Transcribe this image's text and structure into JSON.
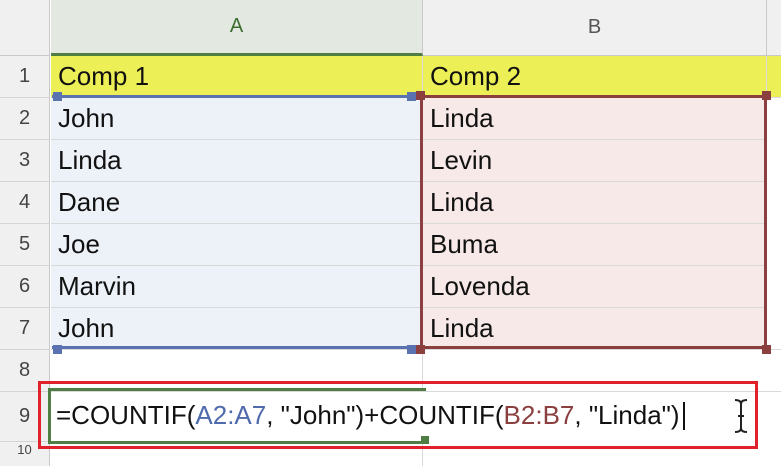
{
  "columns": [
    "A",
    "B"
  ],
  "row_numbers": [
    "1",
    "2",
    "3",
    "4",
    "5",
    "6",
    "7",
    "8",
    "9"
  ],
  "rows": [
    [
      "Comp 1",
      "Comp 2"
    ],
    [
      "John",
      "Linda"
    ],
    [
      "Linda",
      "Levin"
    ],
    [
      "Dane",
      "Linda"
    ],
    [
      "Joe",
      "Buma"
    ],
    [
      "Marvin",
      "Lovenda"
    ],
    [
      "John",
      "Linda"
    ],
    [
      "",
      ""
    ]
  ],
  "formula": {
    "p1": "=COUNTIF(",
    "r1": "A2:A7",
    "p2": ", \"John\")+COUNTIF(",
    "r2": "B2:B7",
    "p3": ", \"Linda\")"
  },
  "partial_row_label": "10",
  "colors": {
    "header_yellow": "#ecef55",
    "range_blue": "#5a73b0",
    "range_red": "#8b3f3f",
    "callout": "#e0202a"
  }
}
